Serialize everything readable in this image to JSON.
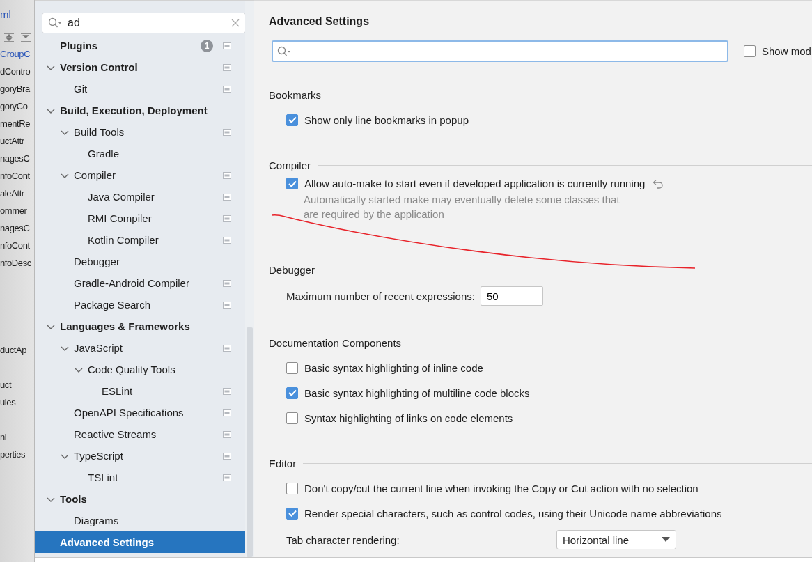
{
  "background_editor": {
    "tab": "ml",
    "blocks": [
      [
        {
          "text": "GroupC",
          "color": "#2a55b8"
        },
        {
          "text": "dContro",
          "color": "#1e1e1e"
        },
        {
          "text": "goryBra",
          "color": "#1e1e1e"
        },
        {
          "text": "goryCo",
          "color": "#1e1e1e"
        },
        {
          "text": "mentRe",
          "color": "#1e1e1e"
        },
        {
          "text": "uctAttr",
          "color": "#1e1e1e"
        },
        {
          "text": "nagesC",
          "color": "#1e1e1e"
        },
        {
          "text": "nfoCont",
          "color": "#1e1e1e"
        },
        {
          "text": "aleAttr",
          "color": "#1e1e1e"
        },
        {
          "text": "ommer",
          "color": "#1e1e1e"
        },
        {
          "text": "nagesC",
          "color": "#1e1e1e"
        },
        {
          "text": "nfoCont",
          "color": "#1e1e1e"
        },
        {
          "text": "nfoDesc",
          "color": "#1e1e1e"
        }
      ],
      [
        {
          "text": "ductAp",
          "color": "#1e1e1e"
        }
      ],
      [
        {
          "text": "uct",
          "color": "#1e1e1e"
        },
        {
          "text": "ules",
          "color": "#1e1e1e"
        }
      ],
      [
        {
          "text": "nl",
          "color": "#1e1e1e"
        },
        {
          "text": "perties",
          "color": "#1e1e1e"
        }
      ]
    ]
  },
  "tree": {
    "search": {
      "value": "ad"
    },
    "items": [
      {
        "label": "Plugins",
        "badge": "1",
        "project_level": true,
        "selected": false
      },
      {
        "label": "Version Control",
        "expanded": true,
        "project_level": true,
        "selected": false,
        "children": [
          {
            "label": "Git",
            "project_level": true,
            "selected": false
          }
        ]
      },
      {
        "label": "Build, Execution, Deployment",
        "expanded": true,
        "project_level": false,
        "selected": false,
        "children": [
          {
            "label": "Build Tools",
            "expanded": true,
            "project_level": true,
            "selected": false,
            "children": [
              {
                "label": "Gradle",
                "project_level": false,
                "selected": false
              }
            ]
          },
          {
            "label": "Compiler",
            "expanded": true,
            "project_level": true,
            "selected": false,
            "children": [
              {
                "label": "Java Compiler",
                "project_level": true,
                "selected": false
              },
              {
                "label": "RMI Compiler",
                "project_level": true,
                "selected": false
              },
              {
                "label": "Kotlin Compiler",
                "project_level": true,
                "selected": false
              }
            ]
          },
          {
            "label": "Debugger",
            "project_level": false,
            "selected": false
          },
          {
            "label": "Gradle-Android Compiler",
            "project_level": true,
            "selected": false
          },
          {
            "label": "Package Search",
            "project_level": true,
            "selected": false
          }
        ]
      },
      {
        "label": "Languages & Frameworks",
        "expanded": true,
        "project_level": false,
        "selected": false,
        "children": [
          {
            "label": "JavaScript",
            "expanded": true,
            "project_level": true,
            "selected": false,
            "children": [
              {
                "label": "Code Quality Tools",
                "expanded": true,
                "project_level": false,
                "selected": false,
                "children": [
                  {
                    "label": "ESLint",
                    "project_level": true,
                    "selected": false
                  }
                ]
              }
            ]
          },
          {
            "label": "OpenAPI Specifications",
            "project_level": true,
            "selected": false
          },
          {
            "label": "Reactive Streams",
            "project_level": true,
            "selected": false
          },
          {
            "label": "TypeScript",
            "expanded": true,
            "project_level": true,
            "selected": false,
            "children": [
              {
                "label": "TSLint",
                "project_level": true,
                "selected": false
              }
            ]
          }
        ]
      },
      {
        "label": "Tools",
        "expanded": true,
        "project_level": false,
        "selected": false,
        "children": [
          {
            "label": "Diagrams",
            "project_level": false,
            "selected": false
          }
        ]
      },
      {
        "label": "Advanced Settings",
        "project_level": false,
        "selected": true
      }
    ]
  },
  "settings": {
    "title": "Advanced Settings",
    "show_modified": {
      "label": "Show mod",
      "checked": false
    },
    "sections": [
      {
        "title": "Bookmarks",
        "items": [
          {
            "kind": "checkbox",
            "label": "Show only line bookmarks in popup",
            "checked": true
          }
        ]
      },
      {
        "title": "Compiler",
        "items": [
          {
            "kind": "checkbox",
            "label": "Allow auto-make to start even if developed application is currently running",
            "checked": true,
            "modified": true,
            "description": "Automatically started make may eventually delete some classes that are required by the application"
          }
        ]
      },
      {
        "title": "Debugger",
        "items": [
          {
            "kind": "number",
            "label": "Maximum number of recent expressions:",
            "value": "50"
          }
        ]
      },
      {
        "title": "Documentation Components",
        "items": [
          {
            "kind": "checkbox",
            "label": "Basic syntax highlighting of inline code",
            "checked": false
          },
          {
            "kind": "checkbox",
            "label": "Basic syntax highlighting of multiline code blocks",
            "checked": true
          },
          {
            "kind": "checkbox",
            "label": "Syntax highlighting of links on code elements",
            "checked": false
          }
        ]
      },
      {
        "title": "Editor",
        "items": [
          {
            "kind": "checkbox",
            "label": "Don't copy/cut the current line when invoking the Copy or Cut action with no selection",
            "checked": false
          },
          {
            "kind": "checkbox",
            "label": "Render special characters, such as control codes, using their Unicode name abbreviations",
            "checked": true
          },
          {
            "kind": "dropdown",
            "label": "Tab character rendering:",
            "value": "Horizontal line"
          }
        ]
      }
    ]
  }
}
